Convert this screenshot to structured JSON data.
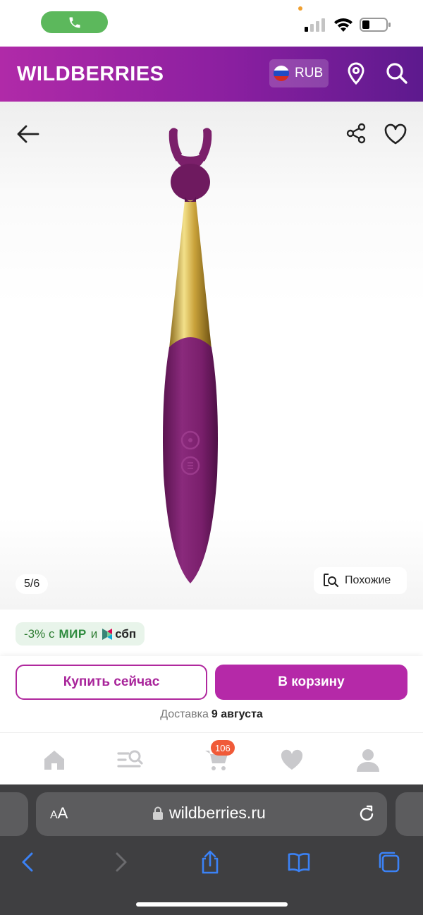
{
  "app": {
    "logo": "WILDBERRIES",
    "currency": "RUB"
  },
  "gallery": {
    "counter": "5/6",
    "similar_label": "Похожие"
  },
  "promo": {
    "discount": "-3% с",
    "mir": "МИР",
    "and": "и",
    "sbp": "сбп"
  },
  "actions": {
    "buy_now": "Купить сейчас",
    "to_cart": "В корзину"
  },
  "delivery": {
    "label": "Доставка",
    "date": "9 августа"
  },
  "nav": {
    "cart_count": "106"
  },
  "browser": {
    "aa_small": "A",
    "aa_large": "A",
    "url": "wildberries.ru"
  },
  "colors": {
    "brand": "#b529a8",
    "product": "#7b1f6a",
    "gold": "#d4b04a",
    "promo_green": "#2e7d32"
  }
}
